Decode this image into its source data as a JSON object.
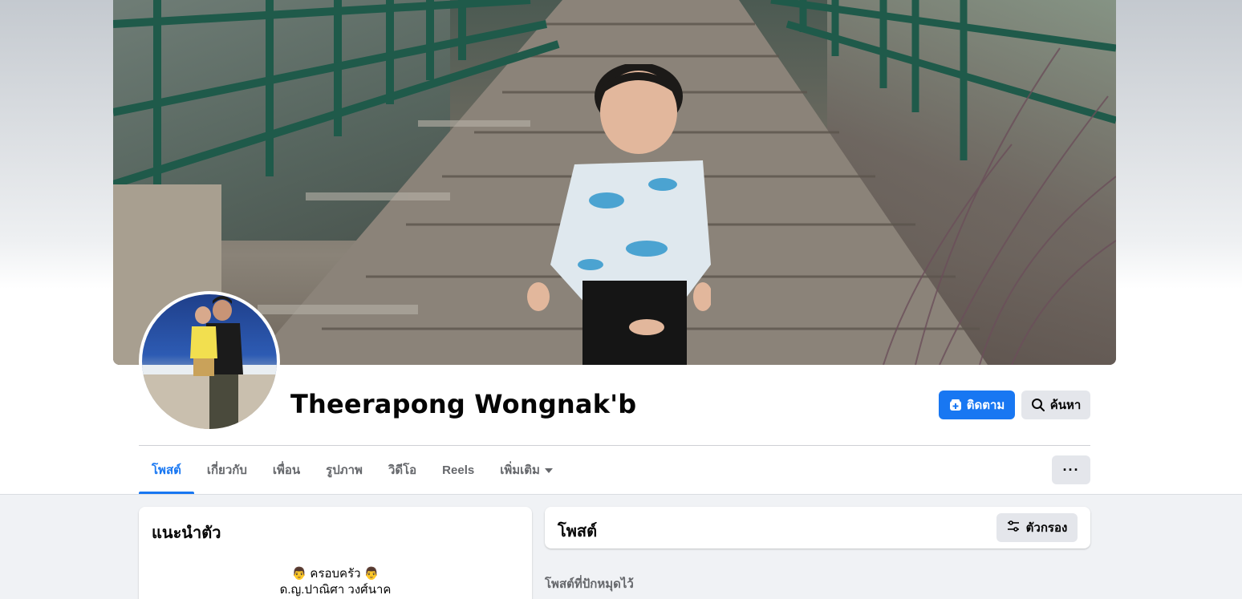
{
  "profile": {
    "name": "Theerapong Wongnak'b"
  },
  "actions": {
    "follow_label": "ติดตาม",
    "search_label": "ค้นหา",
    "more_label": "···"
  },
  "tabs": [
    {
      "label": "โพสต์",
      "active": true
    },
    {
      "label": "เกี่ยวกับ",
      "active": false
    },
    {
      "label": "เพื่อน",
      "active": false
    },
    {
      "label": "รูปภาพ",
      "active": false
    },
    {
      "label": "วิดีโอ",
      "active": false
    },
    {
      "label": "Reels",
      "active": false
    },
    {
      "label": "เพิ่มเติม",
      "active": false
    }
  ],
  "intro": {
    "title": "แนะนำตัว",
    "bio_line1": "👨 ครอบครัว 👨",
    "bio_line2": "ด.ญ.ปาณิศา วงศ์นาค"
  },
  "posts": {
    "title": "โพสต์",
    "filter_label": "ตัวกรอง",
    "pinned_label": "โพสต์ที่ปักหมุดไว้"
  },
  "colors": {
    "accent": "#1877f2",
    "background": "#f0f2f5",
    "button_gray": "#e4e6eb",
    "muted_text": "#65676b"
  },
  "icons": {
    "follow": "user-plus-icon",
    "search": "search-icon",
    "filter": "filter-sliders-icon",
    "more": "more-dots-icon",
    "dropdown": "caret-down-icon"
  }
}
